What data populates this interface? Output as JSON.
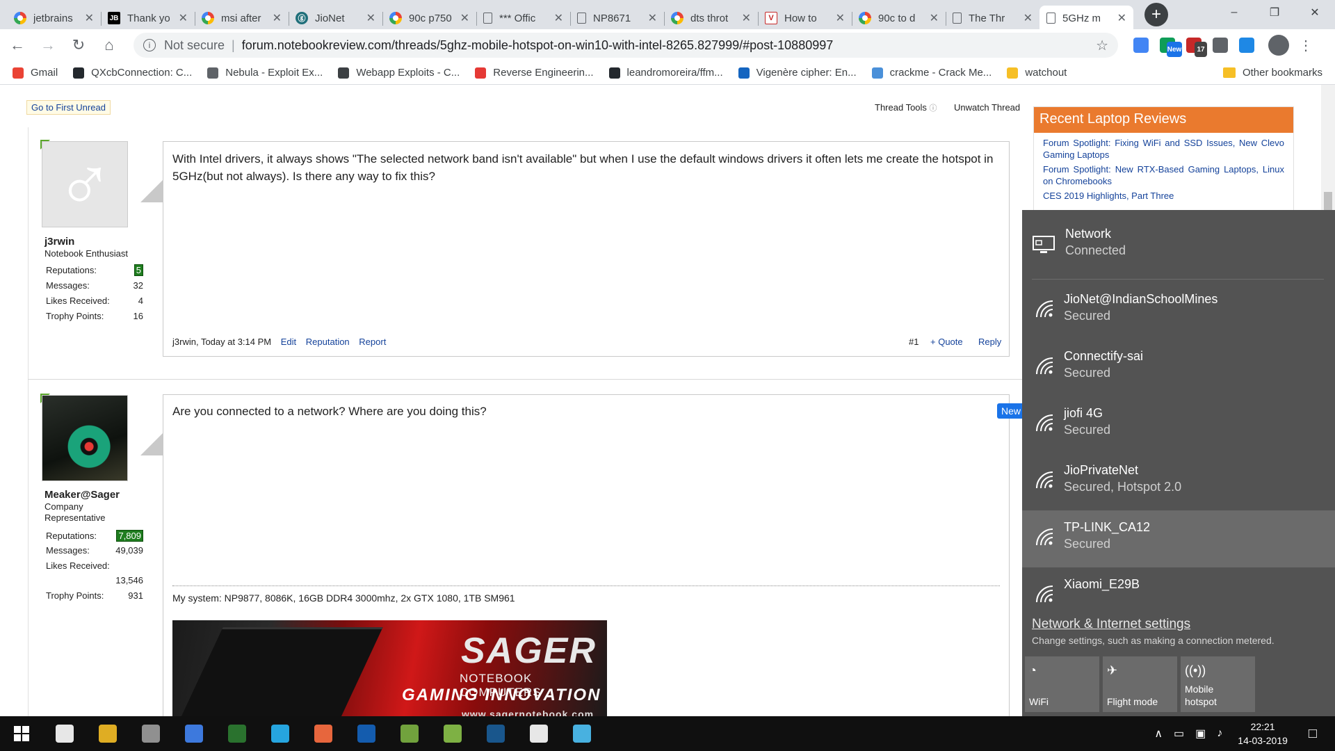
{
  "browser": {
    "tabs": [
      {
        "title": "jetbrains",
        "icon": "google-icon",
        "active": false
      },
      {
        "title": "Thank yo",
        "icon": "jetbrains-icon",
        "active": false
      },
      {
        "title": "msi after",
        "icon": "google-icon",
        "active": false
      },
      {
        "title": "JioNet",
        "icon": "jionet-icon",
        "active": false
      },
      {
        "title": "90c p750",
        "icon": "google-icon",
        "active": false
      },
      {
        "title": "*** Offic",
        "icon": "document-icon",
        "active": false
      },
      {
        "title": "NP8671",
        "icon": "document-icon",
        "active": false
      },
      {
        "title": "dts throt",
        "icon": "google-icon",
        "active": false
      },
      {
        "title": "How to",
        "icon": "v-icon",
        "active": false
      },
      {
        "title": "90c to d",
        "icon": "google-icon",
        "active": false
      },
      {
        "title": "The Thr",
        "icon": "document-icon",
        "active": false
      },
      {
        "title": "5GHz m",
        "icon": "document-icon",
        "active": true
      }
    ],
    "security_label": "Not secure",
    "url": "forum.notebookreview.com/threads/5ghz-mobile-hotspot-on-win10-with-intel-8265.827999/#post-10880997",
    "extensions": [
      {
        "name": "translate-extension-icon",
        "color": "#4285f4",
        "badge": ""
      },
      {
        "name": "new-extension-icon",
        "color": "#0f9d58",
        "badge": "New"
      },
      {
        "name": "ublock-extension-icon",
        "color": "#c62828",
        "badge": "17"
      },
      {
        "name": "dots-extension-icon",
        "color": "#5f6368",
        "badge": ""
      },
      {
        "name": "globe-extension-icon",
        "color": "#1e88e5",
        "badge": ""
      }
    ],
    "bookmarks": [
      {
        "label": "Gmail",
        "color": "#ea4335"
      },
      {
        "label": "QXcbConnection: C...",
        "color": "#24292e"
      },
      {
        "label": "Nebula - Exploit Ex...",
        "color": "#5f6368"
      },
      {
        "label": "Webapp Exploits - C...",
        "color": "#3c4043"
      },
      {
        "label": "Reverse Engineerin...",
        "color": "#e53935"
      },
      {
        "label": "leandromoreira/ffm...",
        "color": "#24292e"
      },
      {
        "label": "Vigenère cipher: En...",
        "color": "#1565c0"
      },
      {
        "label": "crackme - Crack Me...",
        "color": "#4a90d9"
      },
      {
        "label": "watchout",
        "color": "#f6bf26"
      }
    ],
    "bookmarks_more": "»",
    "other_bookmarks": "Other bookmarks"
  },
  "forum": {
    "first_unread": "Go to First Unread",
    "thread_tools": "Thread Tools",
    "unwatch": "Unwatch Thread",
    "posts": [
      {
        "username": "j3rwin",
        "user_title": "Notebook Enthusiast",
        "stats": [
          {
            "label": "Reputations:",
            "value": "5"
          },
          {
            "label": "Messages:",
            "value": "32"
          },
          {
            "label": "Likes Received:",
            "value": "4"
          },
          {
            "label": "Trophy Points:",
            "value": "16"
          }
        ],
        "message": "With Intel drivers, it always shows \"The selected network band isn't available\" but when I use the default windows drivers it often lets me create the hotspot in 5GHz(but not always). Is there any way to fix this?",
        "meta": "j3rwin, Today at 3:14 PM",
        "actions": [
          "Edit",
          "Reputation",
          "Report"
        ],
        "number": "#1",
        "quote": "+ Quote",
        "reply": "Reply"
      },
      {
        "username": "Meaker@Sager",
        "user_title": "Company Representative",
        "stats": [
          {
            "label": "Reputations:",
            "value": "7,809"
          },
          {
            "label": "Messages:",
            "value": "49,039"
          },
          {
            "label": "Likes Received:",
            "value": "13,546"
          },
          {
            "label": "Trophy Points:",
            "value": "931"
          }
        ],
        "message": "Are you connected to a network? Where are you doing this?",
        "badge": "New",
        "signature": "My system: NP9877, 8086K, 16GB DDR4 3000mhz, 2x GTX 1080, 1TB SM961",
        "banner": {
          "logo": "SAGER",
          "line1": "NOTEBOOK COMPUTERS",
          "line2": "GAMING INNOVATION",
          "url": "www.sagernotebook.com"
        }
      }
    ],
    "sidebar": {
      "title": "Recent Laptop Reviews",
      "items": [
        "Forum Spotlight: Fixing WiFi and SSD Issues, New Clevo Gaming Laptops",
        "Forum Spotlight: New RTX-Based Gaming Laptops, Linux on Chromebooks",
        "CES 2019 Highlights, Part Three"
      ]
    }
  },
  "network_flyout": {
    "connected": {
      "name": "Network",
      "status": "Connected"
    },
    "networks": [
      {
        "name": "JioNet@IndianSchoolMines",
        "status": "Secured"
      },
      {
        "name": "Connectify-sai",
        "status": "Secured"
      },
      {
        "name": "jiofi 4G",
        "status": "Secured"
      },
      {
        "name": "JioPrivateNet",
        "status": "Secured, Hotspot 2.0"
      },
      {
        "name": "TP-LINK_CA12",
        "status": "Secured"
      },
      {
        "name": "Xiaomi_E29B",
        "status": ""
      }
    ],
    "settings_link": "Network & Internet settings",
    "settings_desc": "Change settings, such as making a connection metered.",
    "quick_actions": [
      {
        "label": "WiFi",
        "icon": "wifi-icon"
      },
      {
        "label": "Flight mode",
        "icon": "airplane-icon"
      },
      {
        "label": "Mobile hotspot",
        "icon": "hotspot-icon"
      }
    ]
  },
  "taskbar": {
    "apps": [
      {
        "name": "task-view-icon",
        "color": "#ffffff"
      },
      {
        "name": "file-explorer-icon",
        "color": "#f6bf26"
      },
      {
        "name": "store-icon",
        "color": "#9e9e9e"
      },
      {
        "name": "chrome-icon",
        "color": "#4285f4"
      },
      {
        "name": "earth-icon",
        "color": "#2e7d32"
      },
      {
        "name": "network-app-icon",
        "color": "#29b6f6"
      },
      {
        "name": "firefox-icon",
        "color": "#ff7043"
      },
      {
        "name": "outlook-icon",
        "color": "#1565c0"
      },
      {
        "name": "android-studio-icon",
        "color": "#7cb342"
      },
      {
        "name": "android-icon",
        "color": "#8bc34a"
      },
      {
        "name": "steam-icon",
        "color": "#1b5e9a"
      },
      {
        "name": "settings-icon",
        "color": "#ffffff"
      },
      {
        "name": "app-icon",
        "color": "#4fc3f7"
      }
    ],
    "time": "22:21",
    "date": "14-03-2019"
  }
}
